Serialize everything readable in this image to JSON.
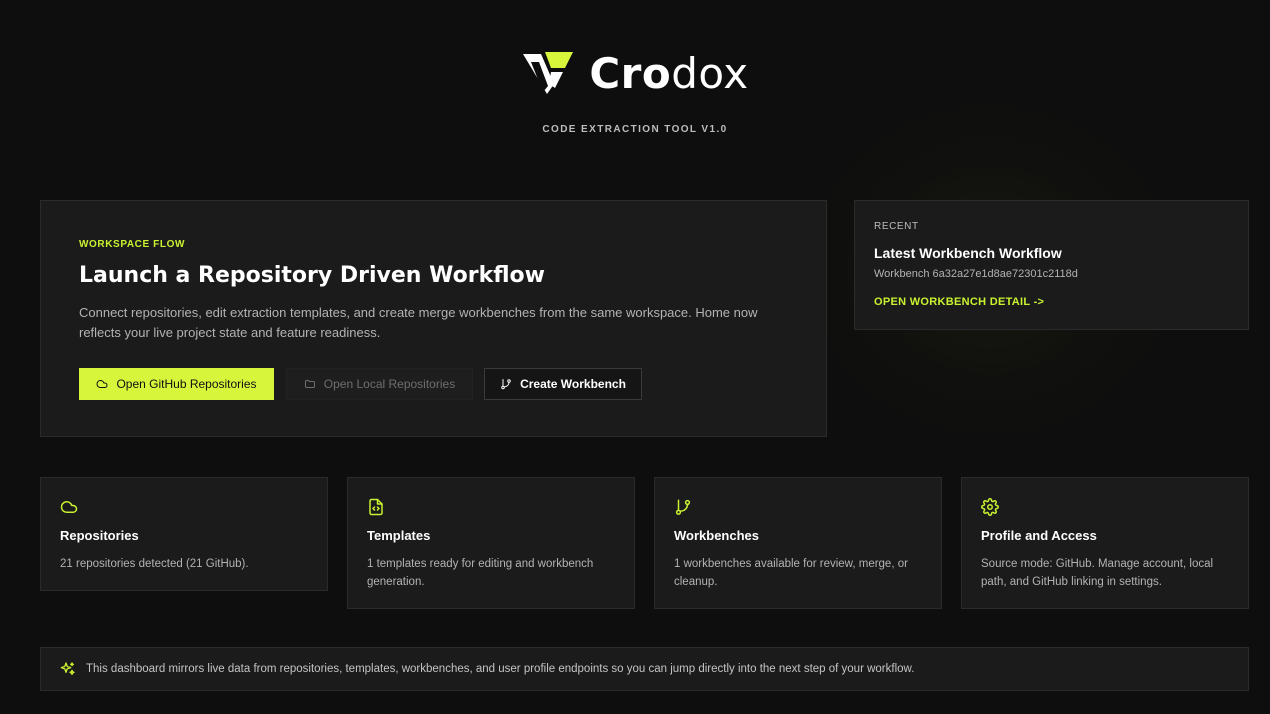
{
  "brand": {
    "name_bold": "Cro",
    "name_light": "dox",
    "subtitle": "CODE EXTRACTION TOOL V1.0",
    "accent_color": "#d6f53b"
  },
  "hero": {
    "eyebrow": "WORKSPACE FLOW",
    "title": "Launch a Repository Driven Workflow",
    "description": "Connect repositories, edit extraction templates, and create merge workbenches from the same workspace. Home now reflects your live project state and feature readiness.",
    "buttons": {
      "github": {
        "label": "Open GitHub Repositories",
        "icon": "cloud-icon"
      },
      "local": {
        "label": "Open Local Repositories",
        "icon": "folder-icon"
      },
      "workbench": {
        "label": "Create Workbench",
        "icon": "git-branch-icon"
      }
    }
  },
  "recent": {
    "eyebrow": "RECENT",
    "title": "Latest Workbench Workflow",
    "id_text": "Workbench 6a32a27e1d8ae72301c2118d",
    "link": "OPEN WORKBENCH DETAIL ->"
  },
  "features": [
    {
      "icon": "cloud-icon",
      "title": "Repositories",
      "description": "21 repositories detected (21 GitHub)."
    },
    {
      "icon": "file-code-icon",
      "title": "Templates",
      "description": "1 templates ready for editing and workbench generation."
    },
    {
      "icon": "git-branch-icon",
      "title": "Workbenches",
      "description": "1 workbenches available for review, merge, or cleanup."
    },
    {
      "icon": "gear-icon",
      "title": "Profile and Access",
      "description": "Source mode: GitHub. Manage account, local path, and GitHub linking in settings."
    }
  ],
  "note": {
    "icon": "sparkles-icon",
    "text": "This dashboard mirrors live data from repositories, templates, workbenches, and user profile endpoints so you can jump directly into the next step of your workflow."
  }
}
